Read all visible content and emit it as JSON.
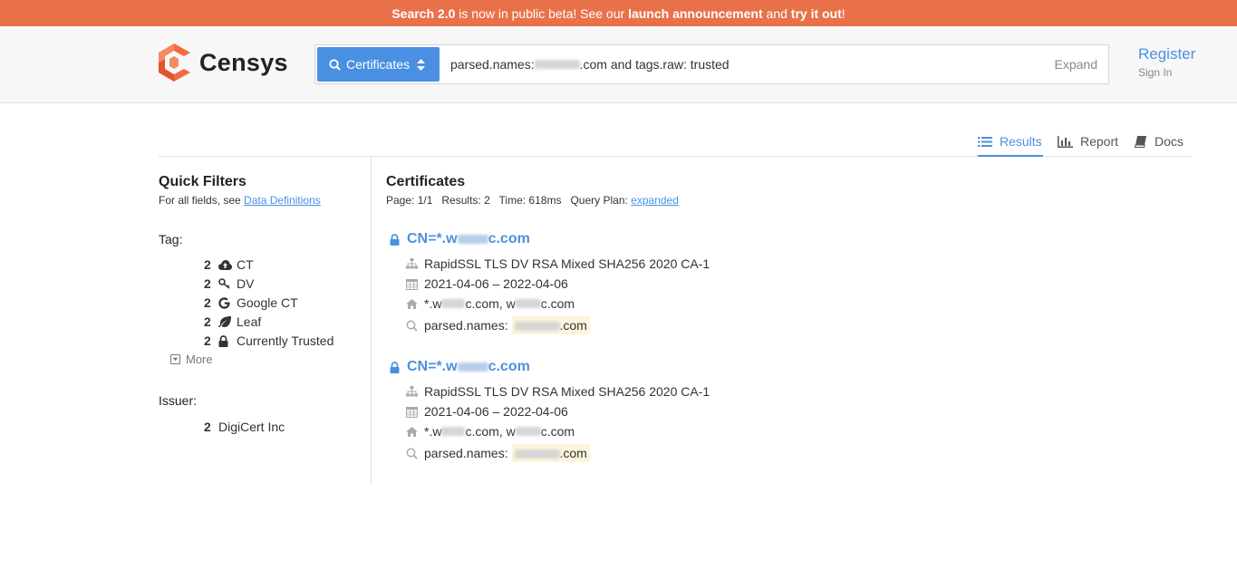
{
  "banner": {
    "lead": "Search 2.0",
    "text1": " is now in public beta! See our ",
    "link1": "launch announcement",
    "text2": " and ",
    "link2": "try it out",
    "text3": "!"
  },
  "header": {
    "logo_text": "Censys",
    "search_type": "Certificates",
    "query_prefix": "parsed.names:",
    "query_suffix": ".com and tags.raw: trusted",
    "expand_label": "Expand",
    "register_label": "Register",
    "signin_label": "Sign In"
  },
  "tabs": [
    {
      "label": "Results",
      "icon": "list-icon",
      "active": true
    },
    {
      "label": "Report",
      "icon": "bar-chart-icon",
      "active": false
    },
    {
      "label": "Docs",
      "icon": "book-icon",
      "active": false
    }
  ],
  "sidebar": {
    "title": "Quick Filters",
    "subtitle_prefix": "For all fields, see ",
    "subtitle_link": "Data Definitions",
    "tag_label": "Tag:",
    "tags": [
      {
        "count": "2",
        "label": "CT",
        "icon": "cloud-upload-icon"
      },
      {
        "count": "2",
        "label": "DV",
        "icon": "key-icon"
      },
      {
        "count": "2",
        "label": "Google CT",
        "icon": "google-icon"
      },
      {
        "count": "2",
        "label": "Leaf",
        "icon": "leaf-icon"
      },
      {
        "count": "2",
        "label": "Currently Trusted",
        "icon": "lock-icon"
      }
    ],
    "more_label": "More",
    "issuer_label": "Issuer:",
    "issuers": [
      {
        "count": "2",
        "label": "DigiCert Inc"
      }
    ]
  },
  "results": {
    "title": "Certificates",
    "page": "Page: 1/1",
    "count": "Results: 2",
    "time": "Time: 618ms",
    "query_plan_label": "Query Plan: ",
    "query_plan_link": "expanded",
    "items": [
      {
        "cn_prefix": "CN=*.w",
        "cn_suffix": "c.com",
        "issuer": "RapidSSL TLS DV RSA Mixed SHA256 2020 CA-1",
        "validity": "2021-04-06 – 2022-04-06",
        "names_a": "*.w",
        "names_b": "c.com, w",
        "names_c": "c.com",
        "match_label": "parsed.names:",
        "match_suffix": ".com"
      },
      {
        "cn_prefix": "CN=*.w",
        "cn_suffix": "c.com",
        "issuer": "RapidSSL TLS DV RSA Mixed SHA256 2020 CA-1",
        "validity": "2021-04-06 – 2022-04-06",
        "names_a": "*.w",
        "names_b": "c.com, w",
        "names_c": "c.com",
        "match_label": "parsed.names:",
        "match_suffix": ".com"
      }
    ]
  },
  "colors": {
    "banner": "#e9714a",
    "accent": "#4a90e2",
    "logo": "#f26a3d",
    "highlight": "#fdf6dc"
  }
}
